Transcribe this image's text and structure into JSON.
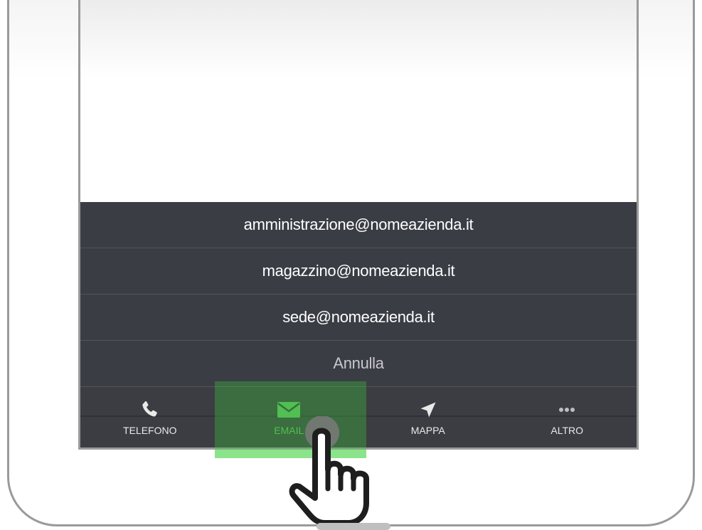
{
  "action_sheet": {
    "items": [
      {
        "label": "amministrazione@nomeazienda.it"
      },
      {
        "label": "magazzino@nomeazienda.it"
      },
      {
        "label": "sede@nomeazienda.it"
      }
    ],
    "cancel_label": "Annulla"
  },
  "tabbar": {
    "tabs": [
      {
        "label": "TELEFONO",
        "icon": "phone-icon"
      },
      {
        "label": "EMAIL",
        "icon": "envelope-icon",
        "active": true
      },
      {
        "label": "MAPPA",
        "icon": "navigation-arrow-icon"
      },
      {
        "label": "ALTRO",
        "icon": "more-dots-icon"
      }
    ]
  },
  "colors": {
    "sheet_background": "#3b3d45",
    "tab_active": "#5dbb5d",
    "tap_highlight": "#3cc83c"
  },
  "pointer": {
    "icon": "tap-hand-icon"
  }
}
